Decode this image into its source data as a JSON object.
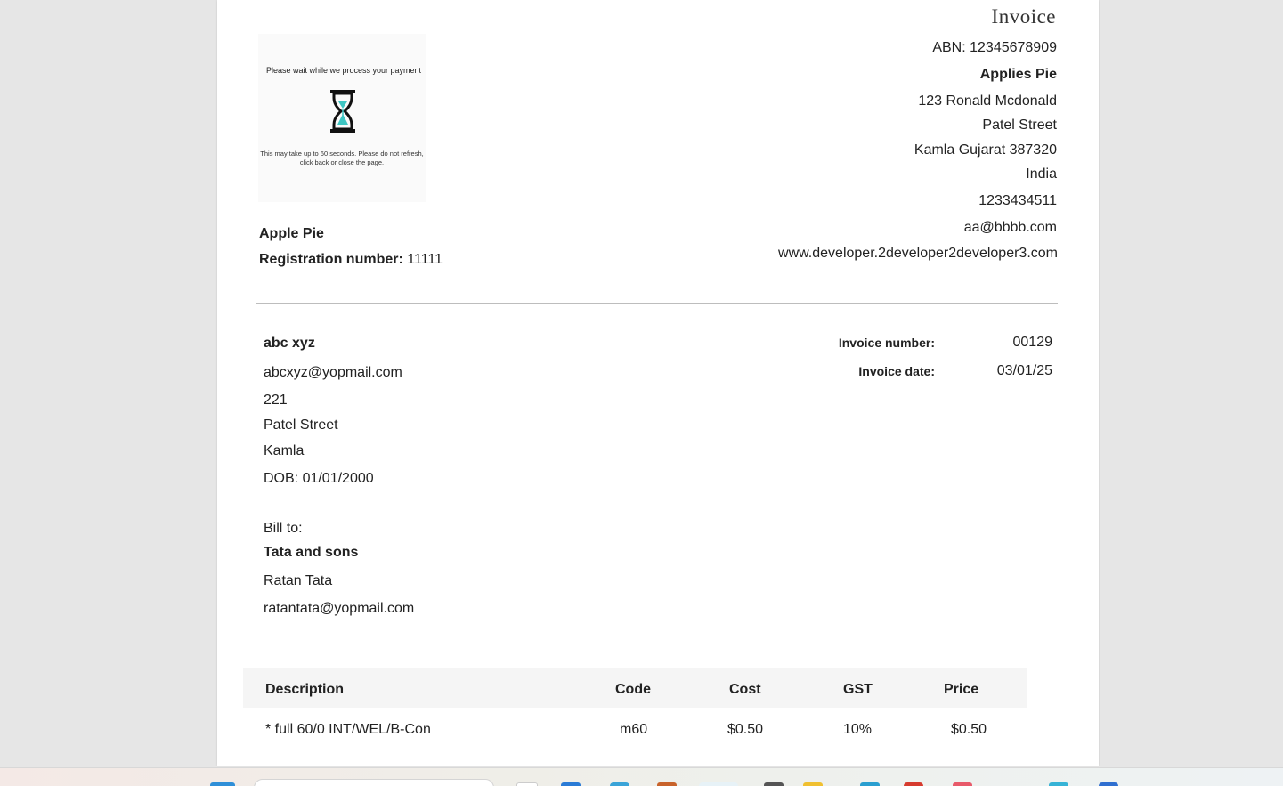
{
  "invoice": {
    "title": "Invoice",
    "abn": "ABN: 12345678909",
    "company_name": "Applies Pie",
    "address_line1": "123 Ronald Mcdonald",
    "address_line2": "Patel Street",
    "address_line3": "Kamla Gujarat 387320",
    "country": "India",
    "phone": "1233434511",
    "email": "aa@bbbb.com",
    "website": "www.developer.2developer2developer3.com"
  },
  "logo": {
    "wait_text": "Please wait while we process your payment",
    "note_text": "This may take up to 60 seconds. Please do not refresh, click back or close the page.",
    "icon": "hourglass-icon"
  },
  "seller": {
    "name": "Apple Pie",
    "registration_label": "Registration number:",
    "registration_value": "11111"
  },
  "customer": {
    "name": "abc xyz",
    "email": "abcxyz@yopmail.com",
    "address_line1": "221",
    "address_line2": "Patel Street",
    "address_line3": "Kamla",
    "dob": "DOB: 01/01/2000"
  },
  "bill_to": {
    "label": "Bill to:",
    "company": "Tata and sons",
    "contact": "Ratan Tata",
    "email": "ratantata@yopmail.com"
  },
  "meta": {
    "number_label": "Invoice number:",
    "number_value": "00129",
    "date_label": "Invoice date:",
    "date_value": "03/01/25"
  },
  "table": {
    "headers": [
      "Description",
      "Code",
      "Cost",
      "GST",
      "Price"
    ],
    "rows": [
      [
        "* full 60/0 INT/WEL/B-Con",
        "m60",
        "$0.50",
        "10%",
        "$0.50"
      ]
    ]
  },
  "colors": {
    "background": "#e6e6e6",
    "page": "#ffffff",
    "table_header_bg": "#f5f5f5",
    "text": "#222222",
    "divider": "#bdbdbd",
    "hourglass_sand": "#3ec6c3"
  }
}
